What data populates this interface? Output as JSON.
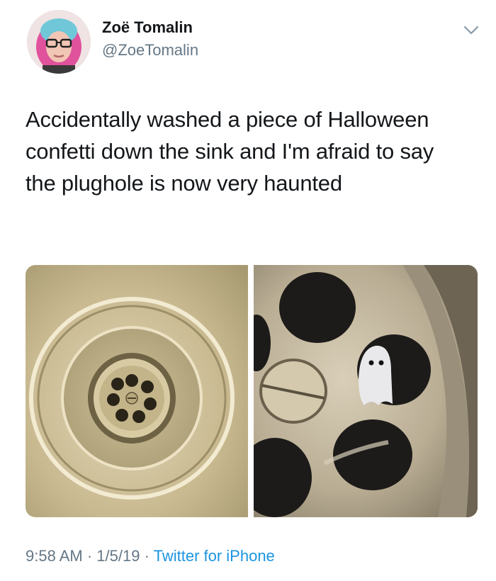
{
  "author": {
    "display_name": "Zoë Tomalin",
    "handle": "@ZoeTomalin"
  },
  "tweet": {
    "text": "Accidentally washed a piece of Halloween confetti down the sink and I'm afraid to say the plughole is now very haunted"
  },
  "media": {
    "images": [
      {
        "subject": "sink-drain-overview"
      },
      {
        "subject": "plughole-closeup-with-ghost-confetti"
      }
    ]
  },
  "meta": {
    "time": "9:58 AM",
    "separator": " · ",
    "date": "1/5/19",
    "source": "Twitter for iPhone"
  },
  "colors": {
    "text": "#14171a",
    "secondary": "#657786",
    "link": "#1b95e0"
  },
  "icons": [
    "chevron-down-icon"
  ]
}
